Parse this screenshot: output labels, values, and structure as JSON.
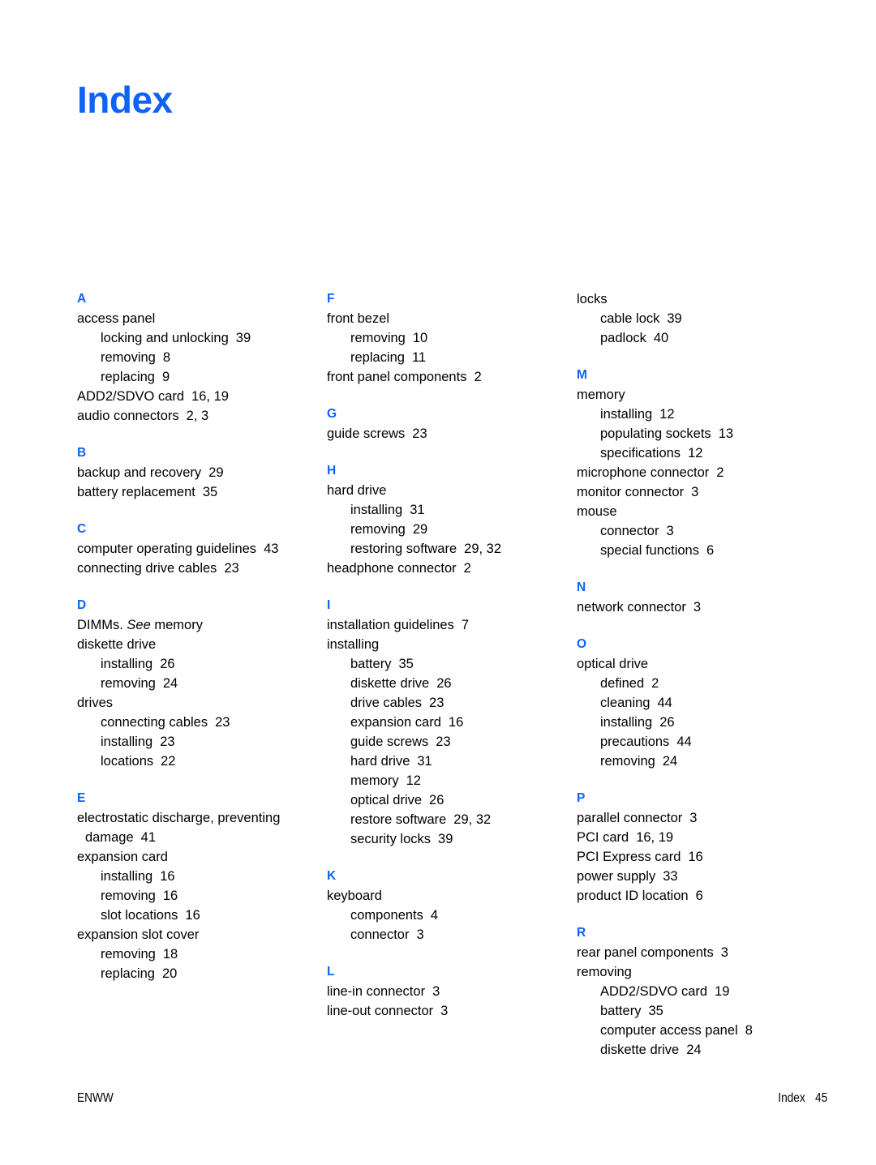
{
  "title": "Index",
  "colors": {
    "heading_blue": "#0e63f4",
    "text_black": "#000000",
    "page_background": "#ffffff"
  },
  "columns": [
    {
      "name": "column-1",
      "groups": [
        {
          "letter": "A",
          "entries": [
            {
              "level": "top",
              "text": "access panel",
              "pages": ""
            },
            {
              "level": "sub",
              "text": "locking and unlocking",
              "pages": "39"
            },
            {
              "level": "sub",
              "text": "removing",
              "pages": "8"
            },
            {
              "level": "sub",
              "text": "replacing",
              "pages": "9"
            },
            {
              "level": "top",
              "text": "ADD2/SDVO card",
              "pages": "16, 19"
            },
            {
              "level": "top",
              "text": "audio connectors",
              "pages": "2, 3"
            }
          ]
        },
        {
          "letter": "B",
          "entries": [
            {
              "level": "top",
              "text": "backup and recovery",
              "pages": "29"
            },
            {
              "level": "top",
              "text": "battery replacement",
              "pages": "35"
            }
          ]
        },
        {
          "letter": "C",
          "entries": [
            {
              "level": "top",
              "text": "computer operating guidelines",
              "pages": "43"
            },
            {
              "level": "top",
              "text": "connecting drive cables",
              "pages": "23"
            }
          ]
        },
        {
          "letter": "D",
          "entries": [
            {
              "level": "top",
              "text": "DIMMs. ",
              "italic": "See",
              "text_after": " memory",
              "pages": ""
            },
            {
              "level": "top",
              "text": "diskette drive",
              "pages": ""
            },
            {
              "level": "sub",
              "text": "installing",
              "pages": "26"
            },
            {
              "level": "sub",
              "text": "removing",
              "pages": "24"
            },
            {
              "level": "top",
              "text": "drives",
              "pages": ""
            },
            {
              "level": "sub",
              "text": "connecting cables",
              "pages": "23"
            },
            {
              "level": "sub",
              "text": "installing",
              "pages": "23"
            },
            {
              "level": "sub",
              "text": "locations",
              "pages": "22"
            }
          ]
        },
        {
          "letter": "E",
          "entries": [
            {
              "level": "top-wrap",
              "text": "electrostatic discharge, preventing damage",
              "pages": "41"
            },
            {
              "level": "top",
              "text": "expansion card",
              "pages": ""
            },
            {
              "level": "sub",
              "text": "installing",
              "pages": "16"
            },
            {
              "level": "sub",
              "text": "removing",
              "pages": "16"
            },
            {
              "level": "sub",
              "text": "slot locations",
              "pages": "16"
            },
            {
              "level": "top",
              "text": "expansion slot cover",
              "pages": ""
            },
            {
              "level": "sub",
              "text": "removing",
              "pages": "18"
            },
            {
              "level": "sub",
              "text": "replacing",
              "pages": "20"
            }
          ]
        }
      ]
    },
    {
      "name": "column-2",
      "groups": [
        {
          "letter": "F",
          "entries": [
            {
              "level": "top",
              "text": "front bezel",
              "pages": ""
            },
            {
              "level": "sub",
              "text": "removing",
              "pages": "10"
            },
            {
              "level": "sub",
              "text": "replacing",
              "pages": "11"
            },
            {
              "level": "top",
              "text": "front panel components",
              "pages": "2"
            }
          ]
        },
        {
          "letter": "G",
          "entries": [
            {
              "level": "top",
              "text": "guide screws",
              "pages": "23"
            }
          ]
        },
        {
          "letter": "H",
          "entries": [
            {
              "level": "top",
              "text": "hard drive",
              "pages": ""
            },
            {
              "level": "sub",
              "text": "installing",
              "pages": "31"
            },
            {
              "level": "sub",
              "text": "removing",
              "pages": "29"
            },
            {
              "level": "sub",
              "text": "restoring software",
              "pages": "29, 32"
            },
            {
              "level": "top",
              "text": "headphone connector",
              "pages": "2"
            }
          ]
        },
        {
          "letter": "I",
          "entries": [
            {
              "level": "top",
              "text": "installation guidelines",
              "pages": "7"
            },
            {
              "level": "top",
              "text": "installing",
              "pages": ""
            },
            {
              "level": "sub",
              "text": "battery",
              "pages": "35"
            },
            {
              "level": "sub",
              "text": "diskette drive",
              "pages": "26"
            },
            {
              "level": "sub",
              "text": "drive cables",
              "pages": "23"
            },
            {
              "level": "sub",
              "text": "expansion card",
              "pages": "16"
            },
            {
              "level": "sub",
              "text": "guide screws",
              "pages": "23"
            },
            {
              "level": "sub",
              "text": "hard drive",
              "pages": "31"
            },
            {
              "level": "sub",
              "text": "memory",
              "pages": "12"
            },
            {
              "level": "sub",
              "text": "optical drive",
              "pages": "26"
            },
            {
              "level": "sub",
              "text": "restore software",
              "pages": "29, 32"
            },
            {
              "level": "sub",
              "text": "security locks",
              "pages": "39"
            }
          ]
        },
        {
          "letter": "K",
          "entries": [
            {
              "level": "top",
              "text": "keyboard",
              "pages": ""
            },
            {
              "level": "sub",
              "text": "components",
              "pages": "4"
            },
            {
              "level": "sub",
              "text": "connector",
              "pages": "3"
            }
          ]
        },
        {
          "letter": "L",
          "entries": [
            {
              "level": "top",
              "text": "line-in connector",
              "pages": "3"
            },
            {
              "level": "top",
              "text": "line-out connector",
              "pages": "3"
            }
          ]
        }
      ]
    },
    {
      "name": "column-3",
      "groups": [
        {
          "letter": "",
          "continuation": true,
          "entries": [
            {
              "level": "top",
              "text": "locks",
              "pages": ""
            },
            {
              "level": "sub",
              "text": "cable lock",
              "pages": "39"
            },
            {
              "level": "sub",
              "text": "padlock",
              "pages": "40"
            }
          ]
        },
        {
          "letter": "M",
          "entries": [
            {
              "level": "top",
              "text": "memory",
              "pages": ""
            },
            {
              "level": "sub",
              "text": "installing",
              "pages": "12"
            },
            {
              "level": "sub",
              "text": "populating sockets",
              "pages": "13"
            },
            {
              "level": "sub",
              "text": "specifications",
              "pages": "12"
            },
            {
              "level": "top",
              "text": "microphone connector",
              "pages": "2"
            },
            {
              "level": "top",
              "text": "monitor connector",
              "pages": "3"
            },
            {
              "level": "top",
              "text": "mouse",
              "pages": ""
            },
            {
              "level": "sub",
              "text": "connector",
              "pages": "3"
            },
            {
              "level": "sub",
              "text": "special functions",
              "pages": "6"
            }
          ]
        },
        {
          "letter": "N",
          "entries": [
            {
              "level": "top",
              "text": "network connector",
              "pages": "3"
            }
          ]
        },
        {
          "letter": "O",
          "entries": [
            {
              "level": "top",
              "text": "optical drive",
              "pages": ""
            },
            {
              "level": "sub",
              "text": "defined",
              "pages": "2"
            },
            {
              "level": "sub",
              "text": "cleaning",
              "pages": "44"
            },
            {
              "level": "sub",
              "text": "installing",
              "pages": "26"
            },
            {
              "level": "sub",
              "text": "precautions",
              "pages": "44"
            },
            {
              "level": "sub",
              "text": "removing",
              "pages": "24"
            }
          ]
        },
        {
          "letter": "P",
          "entries": [
            {
              "level": "top",
              "text": "parallel connector",
              "pages": "3"
            },
            {
              "level": "top",
              "text": "PCI card",
              "pages": "16, 19"
            },
            {
              "level": "top",
              "text": "PCI Express card",
              "pages": "16"
            },
            {
              "level": "top",
              "text": "power supply",
              "pages": "33"
            },
            {
              "level": "top",
              "text": "product ID location",
              "pages": "6"
            }
          ]
        },
        {
          "letter": "R",
          "entries": [
            {
              "level": "top",
              "text": "rear panel components",
              "pages": "3"
            },
            {
              "level": "top",
              "text": "removing",
              "pages": ""
            },
            {
              "level": "sub",
              "text": "ADD2/SDVO card",
              "pages": "19"
            },
            {
              "level": "sub",
              "text": "battery",
              "pages": "35"
            },
            {
              "level": "sub",
              "text": "computer access panel",
              "pages": "8"
            },
            {
              "level": "sub",
              "text": "diskette drive",
              "pages": "24"
            }
          ]
        }
      ]
    }
  ],
  "footer": {
    "left": "ENWW",
    "right_label": "Index",
    "right_page": "45"
  }
}
